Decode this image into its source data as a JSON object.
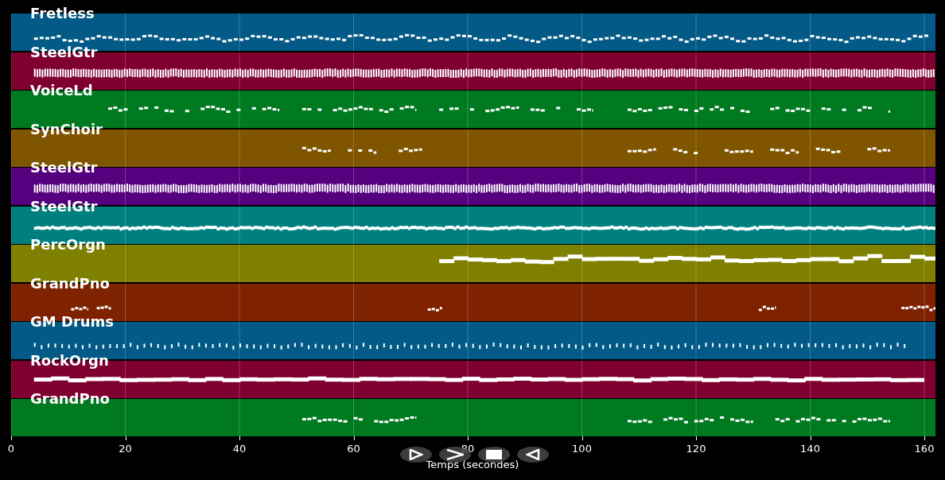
{
  "tracks": [
    {
      "name": "Fretless",
      "color": "#035a86",
      "kind": "melody"
    },
    {
      "name": "SteelGtr",
      "color": "#7f0030",
      "kind": "strum"
    },
    {
      "name": "VoiceLd",
      "color": "#007a20",
      "kind": "phrases"
    },
    {
      "name": "SynChoir",
      "color": "#7f5500",
      "kind": "backing"
    },
    {
      "name": "SteelGtr",
      "color": "#55007f",
      "kind": "strum"
    },
    {
      "name": "SteelGtr",
      "color": "#007f7f",
      "kind": "picking"
    },
    {
      "name": "PercOrgn",
      "color": "#7f7f00",
      "kind": "pad"
    },
    {
      "name": "GrandPno",
      "color": "#7f2200",
      "kind": "accents"
    },
    {
      "name": "GM Drums",
      "color": "#035a86",
      "kind": "drums"
    },
    {
      "name": "RockOrgn",
      "color": "#7f0030",
      "kind": "organ"
    },
    {
      "name": "GrandPno",
      "color": "#007a20",
      "kind": "piano"
    }
  ],
  "axis": {
    "ticks": [
      "0",
      "20",
      "40",
      "60",
      "80",
      "100",
      "120",
      "140",
      "160"
    ],
    "label": "Temps (secondes)"
  },
  "controls": [
    {
      "kind": "play"
    },
    {
      "kind": "forward"
    },
    {
      "kind": "stop"
    },
    {
      "kind": "back"
    }
  ]
}
